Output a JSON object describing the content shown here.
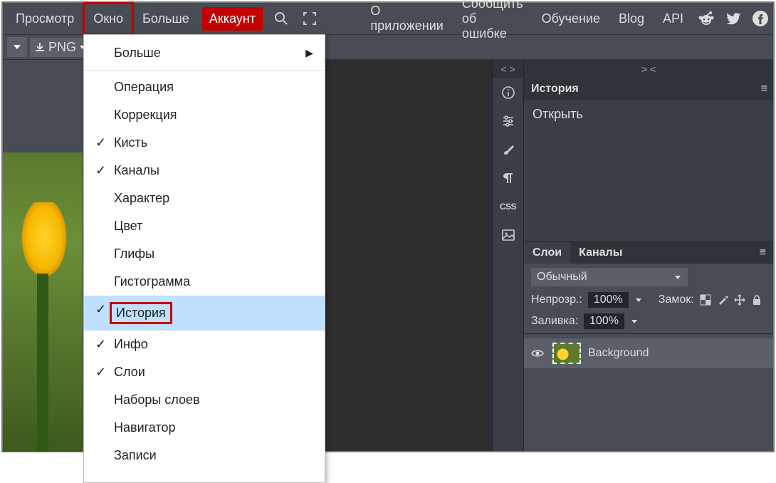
{
  "menubar": {
    "view": "Просмотр",
    "window": "Окно",
    "more": "Больше",
    "account": "Аккаунт",
    "about": "О приложении",
    "report": "Сообщить об ошибке",
    "learn": "Обучение",
    "blog": "Blog",
    "api": "API"
  },
  "subbar": {
    "png": "PNG"
  },
  "dropdown": {
    "more": "Больше",
    "operation": "Операция",
    "correction": "Коррекция",
    "brush": "Кисть",
    "channels": "Каналы",
    "character": "Характер",
    "color": "Цвет",
    "glyphs": "Глифы",
    "histogram": "Гистограмма",
    "history": "История",
    "info": "Инфо",
    "layers": "Слои",
    "layersets": "Наборы слоев",
    "navigator": "Навигатор",
    "records": "Записи"
  },
  "rightstrip": {
    "css": "CSS"
  },
  "history_panel": {
    "title": "История",
    "open": "Открыть"
  },
  "layers_panel": {
    "tab_layers": "Слои",
    "tab_channels": "Каналы",
    "blend": "Обычный",
    "opacity_label": "Непрозр.:",
    "opacity_val": "100%",
    "lock_label": "Замок:",
    "fill_label": "Заливка:",
    "fill_val": "100%",
    "layer0": "Background"
  }
}
